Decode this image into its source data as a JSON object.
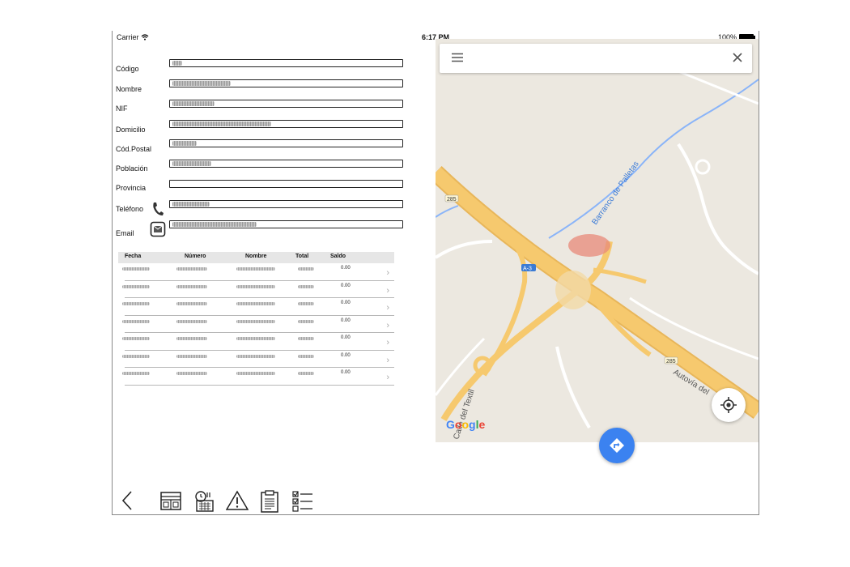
{
  "status_bar": {
    "carrier": "Carrier",
    "time": "6:17 PM",
    "battery": "100%"
  },
  "form": {
    "fields": [
      {
        "label": "Código",
        "value_blurred": true
      },
      {
        "label": "Nombre",
        "value_blurred": true
      },
      {
        "label": "NIF",
        "value_blurred": true
      },
      {
        "label": "Domicilio",
        "value_blurred": true
      },
      {
        "label": "Cód.Postal",
        "value_blurred": true
      },
      {
        "label": "Población",
        "value_blurred": true
      },
      {
        "label": "Provincia",
        "value_blurred": false
      },
      {
        "label": "Teléfono",
        "value_blurred": true
      },
      {
        "label": "Email",
        "value_blurred": true
      }
    ],
    "phone_icon": "phone-icon",
    "email_icon": "email-icon"
  },
  "table": {
    "columns": [
      "Fecha",
      "Número",
      "Nombre",
      "Total",
      "Saldo"
    ],
    "rows": [
      {
        "saldo": "0.00"
      },
      {
        "saldo": "0.00"
      },
      {
        "saldo": "0.00"
      },
      {
        "saldo": "0.00"
      },
      {
        "saldo": "0.00"
      },
      {
        "saldo": "0.00"
      },
      {
        "saldo": "0.00"
      }
    ],
    "row_chevron": "chevron-right-icon"
  },
  "toolbar": {
    "icons": [
      "back-chevron-icon",
      "layout-icon",
      "schedule-calendar-icon",
      "warning-icon",
      "clipboard-icon",
      "checklist-icon"
    ]
  },
  "map": {
    "road_labels": [
      "Barranco de Palletas",
      "A-3",
      "285",
      "285",
      "Autovía del",
      "Calle del Textil"
    ],
    "google_logo": "Google",
    "menu_icon": "hamburger-menu-icon",
    "close_icon": "close-icon",
    "location_icon": "my-location-icon",
    "directions_icon": "directions-icon",
    "colors": {
      "land": "#ece8e0",
      "highway": "#f6c96e",
      "water": "#8ab4f8",
      "fab": "#3b82f0"
    }
  }
}
